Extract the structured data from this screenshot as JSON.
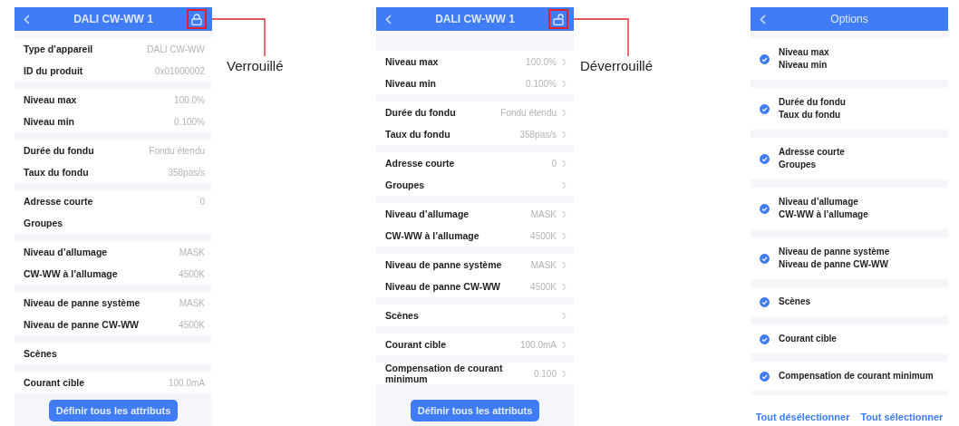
{
  "phones": [
    {
      "kind": "details",
      "title": "DALI CW-WW 1",
      "locked": true,
      "annotation": "Verrouillé",
      "button": "Définir tous les attributs",
      "groups": [
        {
          "rows": [
            {
              "label": "Type d’appareil",
              "value": "DALI CW-WW"
            },
            {
              "label": "ID du produit",
              "value": "0x01000002"
            }
          ]
        },
        {
          "rows": [
            {
              "label": "Niveau max",
              "value": "100.0%"
            },
            {
              "label": "Niveau min",
              "value": "0.100%"
            }
          ]
        },
        {
          "rows": [
            {
              "label": "Durée du fondu",
              "value": "Fondu étendu"
            },
            {
              "label": "Taux du fondu",
              "value": "358pas/s"
            }
          ]
        },
        {
          "rows": [
            {
              "label": "Adresse courte",
              "value": "0"
            },
            {
              "label": "Groupes"
            }
          ]
        },
        {
          "rows": [
            {
              "label": "Niveau d’allumage",
              "value": "MASK"
            },
            {
              "label": "CW-WW à l’allumage",
              "value": "4500K"
            }
          ]
        },
        {
          "rows": [
            {
              "label": "Niveau de panne système",
              "value": "MASK"
            },
            {
              "label": "Niveau de panne CW-WW",
              "value": "4500K"
            }
          ]
        },
        {
          "rows": [
            {
              "label": "Scènes"
            }
          ]
        },
        {
          "rows": [
            {
              "label": "Courant cible",
              "value": "100.0mA"
            }
          ]
        }
      ]
    },
    {
      "kind": "details",
      "title": "DALI CW-WW 1",
      "locked": false,
      "annotation": "Déverrouillé",
      "button": "Définir tous les attributs",
      "groups": [
        {
          "rows": [
            {
              "label": "Niveau max",
              "value": "100.0%"
            },
            {
              "label": "Niveau min",
              "value": "0.100%"
            }
          ]
        },
        {
          "rows": [
            {
              "label": "Durée du fondu",
              "value": "Fondu étendu"
            },
            {
              "label": "Taux du fondu",
              "value": "358pas/s"
            }
          ]
        },
        {
          "rows": [
            {
              "label": "Adresse courte",
              "value": "0"
            },
            {
              "label": "Groupes"
            }
          ]
        },
        {
          "rows": [
            {
              "label": "Niveau d’allumage",
              "value": "MASK"
            },
            {
              "label": "CW-WW à l’allumage",
              "value": "4500K"
            }
          ]
        },
        {
          "rows": [
            {
              "label": "Niveau de panne système",
              "value": "MASK"
            },
            {
              "label": "Niveau de panne CW-WW",
              "value": "4500K"
            }
          ]
        },
        {
          "rows": [
            {
              "label": "Scènes"
            }
          ]
        },
        {
          "rows": [
            {
              "label": "Courant cible",
              "value": "100.0mA"
            }
          ]
        },
        {
          "rows": [
            {
              "label": "Compensation de courant minimum",
              "value": "0.100"
            }
          ]
        }
      ]
    },
    {
      "kind": "options",
      "title": "Options",
      "actions": [
        "Tout désélectionner",
        "Tout sélectionner"
      ],
      "groups": [
        {
          "lines": [
            "Niveau max",
            "Niveau min"
          ],
          "checked": true
        },
        {
          "lines": [
            "Durée du fondu",
            "Taux du fondu"
          ],
          "checked": true
        },
        {
          "lines": [
            "Adresse courte",
            "Groupes"
          ],
          "checked": true
        },
        {
          "lines": [
            "Niveau d’allumage",
            "CW-WW à l’allumage"
          ],
          "checked": true
        },
        {
          "lines": [
            "Niveau de panne système",
            "Niveau de panne CW-WW"
          ],
          "checked": true
        },
        {
          "lines": [
            "Scènes"
          ],
          "checked": true
        },
        {
          "lines": [
            "Courant cible"
          ],
          "checked": true
        },
        {
          "lines": [
            "Compensation de courant minimum"
          ],
          "checked": true
        }
      ]
    }
  ]
}
